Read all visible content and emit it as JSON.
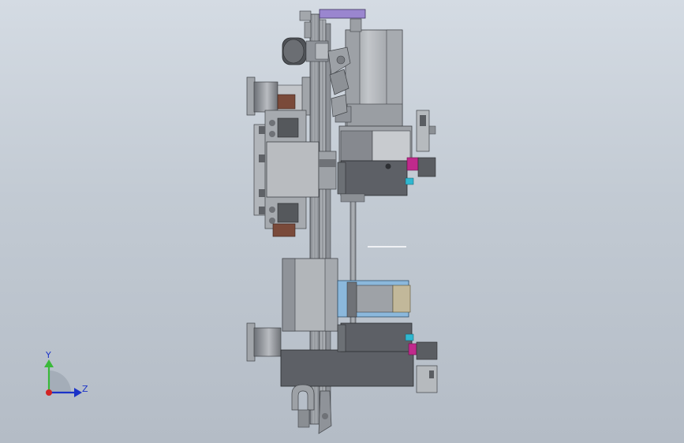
{
  "viewport": {
    "background_top": "#d4dbe3",
    "background_bottom": "#b4bcc6"
  },
  "triad": {
    "y_label": "Y",
    "z_label": "Z",
    "y_axis_color": "#3ab93a",
    "z_axis_color": "#1b33c8",
    "origin_color": "#d22424"
  },
  "colors": {
    "steel": "#8f9399",
    "steel_light": "#c4c7cb",
    "dark_block": "#5d6066",
    "accent_purple": "#9a86cf",
    "accent_blue": "#8bb8dc",
    "accent_rust": "#7a4a3a",
    "accent_magenta": "#c02a8c",
    "accent_cyan": "#30b7d0"
  }
}
